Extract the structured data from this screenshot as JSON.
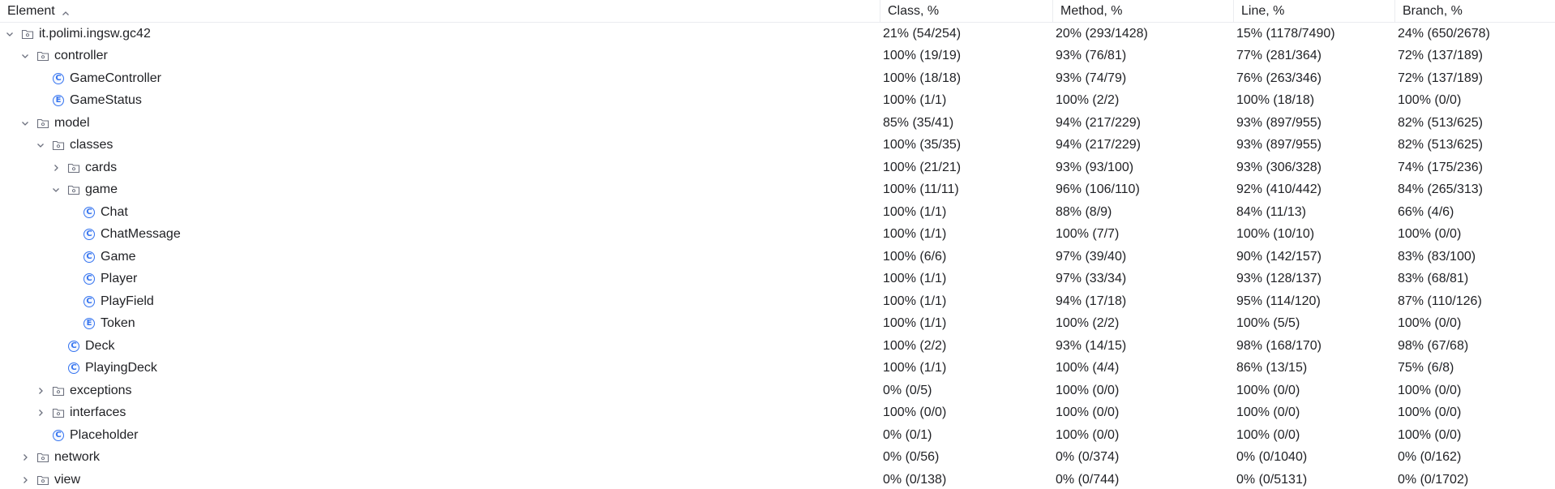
{
  "columns": {
    "element": "Element",
    "class": "Class, %",
    "method": "Method, %",
    "line": "Line, %",
    "branch": "Branch, %"
  },
  "rows": [
    {
      "name": "it.polimi.ingsw.gc42",
      "kind": "package",
      "level": 0,
      "expander": "expanded",
      "class": "21% (54/254)",
      "method": "20% (293/1428)",
      "line": "15% (1178/7490)",
      "branch": "24% (650/2678)"
    },
    {
      "name": "controller",
      "kind": "package",
      "level": 1,
      "expander": "expanded",
      "class": "100% (19/19)",
      "method": "93% (76/81)",
      "line": "77% (281/364)",
      "branch": "72% (137/189)"
    },
    {
      "name": "GameController",
      "kind": "class",
      "level": 2,
      "expander": "none",
      "class": "100% (18/18)",
      "method": "93% (74/79)",
      "line": "76% (263/346)",
      "branch": "72% (137/189)"
    },
    {
      "name": "GameStatus",
      "kind": "enum",
      "level": 2,
      "expander": "none",
      "class": "100% (1/1)",
      "method": "100% (2/2)",
      "line": "100% (18/18)",
      "branch": "100% (0/0)"
    },
    {
      "name": "model",
      "kind": "package",
      "level": 1,
      "expander": "expanded",
      "class": "85% (35/41)",
      "method": "94% (217/229)",
      "line": "93% (897/955)",
      "branch": "82% (513/625)"
    },
    {
      "name": "classes",
      "kind": "package",
      "level": 2,
      "expander": "expanded",
      "class": "100% (35/35)",
      "method": "94% (217/229)",
      "line": "93% (897/955)",
      "branch": "82% (513/625)"
    },
    {
      "name": "cards",
      "kind": "package",
      "level": 3,
      "expander": "collapsed",
      "class": "100% (21/21)",
      "method": "93% (93/100)",
      "line": "93% (306/328)",
      "branch": "74% (175/236)"
    },
    {
      "name": "game",
      "kind": "package",
      "level": 3,
      "expander": "expanded",
      "class": "100% (11/11)",
      "method": "96% (106/110)",
      "line": "92% (410/442)",
      "branch": "84% (265/313)"
    },
    {
      "name": "Chat",
      "kind": "class",
      "level": 4,
      "expander": "none",
      "class": "100% (1/1)",
      "method": "88% (8/9)",
      "line": "84% (11/13)",
      "branch": "66% (4/6)"
    },
    {
      "name": "ChatMessage",
      "kind": "class",
      "level": 4,
      "expander": "none",
      "class": "100% (1/1)",
      "method": "100% (7/7)",
      "line": "100% (10/10)",
      "branch": "100% (0/0)"
    },
    {
      "name": "Game",
      "kind": "class",
      "level": 4,
      "expander": "none",
      "class": "100% (6/6)",
      "method": "97% (39/40)",
      "line": "90% (142/157)",
      "branch": "83% (83/100)"
    },
    {
      "name": "Player",
      "kind": "class",
      "level": 4,
      "expander": "none",
      "class": "100% (1/1)",
      "method": "97% (33/34)",
      "line": "93% (128/137)",
      "branch": "83% (68/81)"
    },
    {
      "name": "PlayField",
      "kind": "class",
      "level": 4,
      "expander": "none",
      "class": "100% (1/1)",
      "method": "94% (17/18)",
      "line": "95% (114/120)",
      "branch": "87% (110/126)"
    },
    {
      "name": "Token",
      "kind": "enum",
      "level": 4,
      "expander": "none",
      "class": "100% (1/1)",
      "method": "100% (2/2)",
      "line": "100% (5/5)",
      "branch": "100% (0/0)"
    },
    {
      "name": "Deck",
      "kind": "class",
      "level": 3,
      "expander": "none",
      "class": "100% (2/2)",
      "method": "93% (14/15)",
      "line": "98% (168/170)",
      "branch": "98% (67/68)"
    },
    {
      "name": "PlayingDeck",
      "kind": "class",
      "level": 3,
      "expander": "none",
      "class": "100% (1/1)",
      "method": "100% (4/4)",
      "line": "86% (13/15)",
      "branch": "75% (6/8)"
    },
    {
      "name": "exceptions",
      "kind": "package",
      "level": 2,
      "expander": "collapsed",
      "class": "0% (0/5)",
      "method": "100% (0/0)",
      "line": "100% (0/0)",
      "branch": "100% (0/0)"
    },
    {
      "name": "interfaces",
      "kind": "package",
      "level": 2,
      "expander": "collapsed",
      "class": "100% (0/0)",
      "method": "100% (0/0)",
      "line": "100% (0/0)",
      "branch": "100% (0/0)"
    },
    {
      "name": "Placeholder",
      "kind": "class",
      "level": 2,
      "expander": "none",
      "class": "0% (0/1)",
      "method": "100% (0/0)",
      "line": "100% (0/0)",
      "branch": "100% (0/0)"
    },
    {
      "name": "network",
      "kind": "package",
      "level": 1,
      "expander": "collapsed",
      "class": "0% (0/56)",
      "method": "0% (0/374)",
      "line": "0% (0/1040)",
      "branch": "0% (0/162)"
    },
    {
      "name": "view",
      "kind": "package",
      "level": 1,
      "expander": "collapsed",
      "class": "0% (0/138)",
      "method": "0% (0/744)",
      "line": "0% (0/5131)",
      "branch": "0% (0/1702)"
    }
  ],
  "icons": {
    "sort": "sort-ascending-icon",
    "package": "folder-package-icon",
    "class": "class-icon",
    "enum": "enum-icon",
    "expanded": "chevron-down-icon",
    "collapsed": "chevron-right-icon",
    "class_letter": "C",
    "enum_letter": "E"
  },
  "colors": {
    "accent": "#3574f0",
    "grid": "#ebecf0",
    "icon_gray": "#6c707e"
  }
}
